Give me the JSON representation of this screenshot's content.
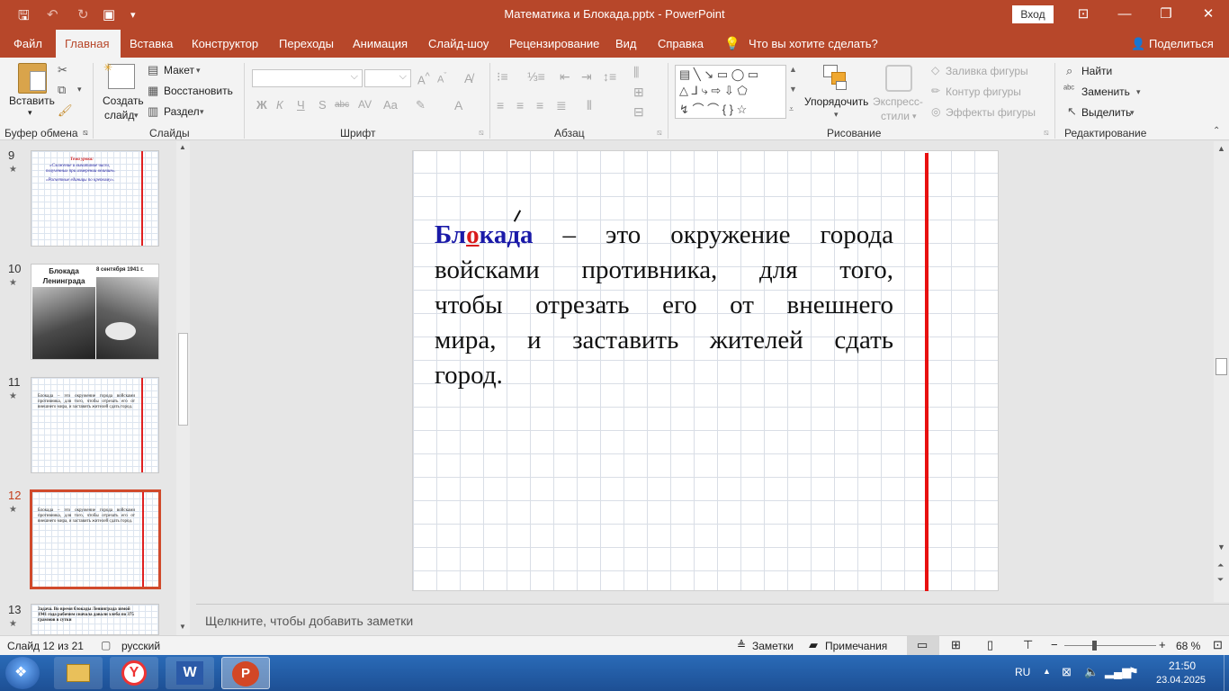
{
  "titlebar": {
    "title": "Математика и Блокада.pptx  -  PowerPoint",
    "signin": "Вход"
  },
  "tabs": [
    "Файл",
    "Главная",
    "Вставка",
    "Конструктор",
    "Переходы",
    "Анимация",
    "Слайд-шоу",
    "Рецензирование",
    "Вид",
    "Справка",
    "Что вы хотите сделать?",
    "Поделиться"
  ],
  "ribbon": {
    "paste": "Вставить",
    "create_slide": "Создать",
    "create_slide2": "слайд",
    "layout": "Макет",
    "reset": "Восстановить",
    "section": "Раздел",
    "arrange": "Упорядочить",
    "quick_styles": "Экспресс-",
    "quick_styles2": "стили",
    "fill": "Заливка фигуры",
    "outline": "Контур фигуры",
    "effects": "Эффекты фигуры",
    "find": "Найти",
    "replace": "Заменить",
    "select": "Выделить",
    "groups": [
      "Буфер обмена",
      "Слайды",
      "Шрифт",
      "Абзац",
      "Рисование",
      "Редактирование"
    ]
  },
  "slides": [
    {
      "num": "9",
      "text": [
        "Тема урока:",
        "«Сложение и вычитание чисел,",
        "полученных при измерении величин».",
        "«Расчетные единицы по крепкому»."
      ]
    },
    {
      "num": "10",
      "title": "Блокада Ленинграда",
      "date": "8 сентября  1941 г."
    },
    {
      "num": "11",
      "text": "Блокада – это окружение города войсками противника, для того, чтобы отрезать его от внешнего мира, и заставить жителей сдать город."
    },
    {
      "num": "12",
      "text": "Блокада – это окружение города войсками противника, для того, чтобы отрезать его от внешнего мира, и заставить жителей сдать город."
    },
    {
      "num": "13",
      "text": "Задача. Во время блокады Ленинграда зимой 1941 года рабочим сначала давали хлеба по 375 граммов в сутки"
    }
  ],
  "slide": {
    "word_b1": "Бл",
    "word_o": "о",
    "word_rest": "када",
    "line1_rest": " – это окружение города",
    "line2": "войсками противника, для того,",
    "line3": "чтобы  отрезать его от внешнего",
    "line4": "мира, и заставить жителей сдать",
    "line5": "город."
  },
  "notes": "Щелкните, чтобы добавить заметки",
  "status": {
    "slide": "Слайд 12 из 21",
    "lang": "русский",
    "notes_btn": "Заметки",
    "comments_btn": "Примечания",
    "zoom": "68 %"
  },
  "taskbar": {
    "lang": "RU",
    "time": "21:50",
    "date": "23.04.2025"
  },
  "colors": {
    "accent": "#b7472a",
    "slide_red_line": "#e81010",
    "keyword_blue": "#1a1aa8"
  }
}
